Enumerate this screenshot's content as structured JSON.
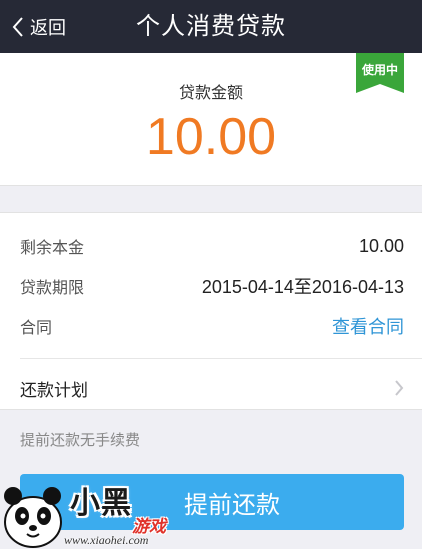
{
  "nav": {
    "back_label": "返回",
    "title": "个人消费贷款"
  },
  "loan": {
    "amount_label": "贷款金额",
    "amount": "10.00",
    "status": "使用中"
  },
  "details": {
    "rows": [
      {
        "key": "剩余本金",
        "value": "10.00"
      },
      {
        "key": "贷款期限",
        "value": "2015-04-14至2016-04-13"
      },
      {
        "key": "合同",
        "value": "查看合同"
      }
    ],
    "plan_label": "还款计划"
  },
  "hint": "提前还款无手续费",
  "prepay_button": "提前还款",
  "watermark": {
    "brand": "小黑",
    "sub": "游戏",
    "url": "www.xiaohei.com"
  },
  "colors": {
    "navbar": "#262936",
    "amount": "#f07a23",
    "badge": "#3aa63a",
    "link": "#2f95d6",
    "button": "#3bacee"
  }
}
